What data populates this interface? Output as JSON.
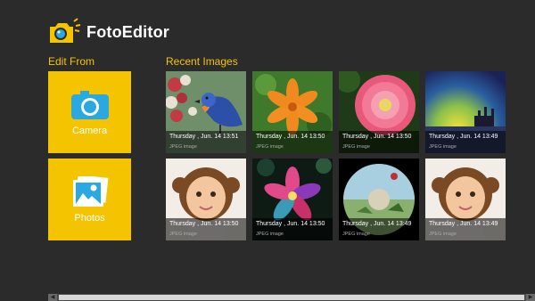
{
  "app": {
    "title": "FotoEditor"
  },
  "edit_from": {
    "heading": "Edit From",
    "tiles": [
      {
        "label": "Camera",
        "icon": "camera-icon"
      },
      {
        "label": "Photos",
        "icon": "photos-icon"
      }
    ]
  },
  "recent": {
    "heading": "Recent Images",
    "images": [
      {
        "date": "Thursday , Jun. 14  13:51",
        "type": "JPEG image",
        "subject": "bird"
      },
      {
        "date": "Thursday , Jun. 14  13:50",
        "type": "JPEG image",
        "subject": "orange-lily"
      },
      {
        "date": "Thursday , Jun. 14  13:50",
        "type": "JPEG image",
        "subject": "pink-flower"
      },
      {
        "date": "Thursday , Jun. 14  13:49",
        "type": "JPEG image",
        "subject": "sunset-city"
      },
      {
        "date": "Thursday , Jun. 14  13:50",
        "type": "JPEG image",
        "subject": "girl-portrait"
      },
      {
        "date": "Thursday , Jun. 14  13:50",
        "type": "JPEG image",
        "subject": "neon-flower"
      },
      {
        "date": "Thursday , Jun. 14  13:49",
        "type": "JPEG image",
        "subject": "fisheye-landscape"
      },
      {
        "date": "Thursday , Jun. 14  13:49",
        "type": "JPEG image",
        "subject": "girl-portrait"
      }
    ]
  },
  "colors": {
    "background": "#2b2b2b",
    "accent": "#f5c400",
    "tile_icon": "#29a9e0"
  }
}
